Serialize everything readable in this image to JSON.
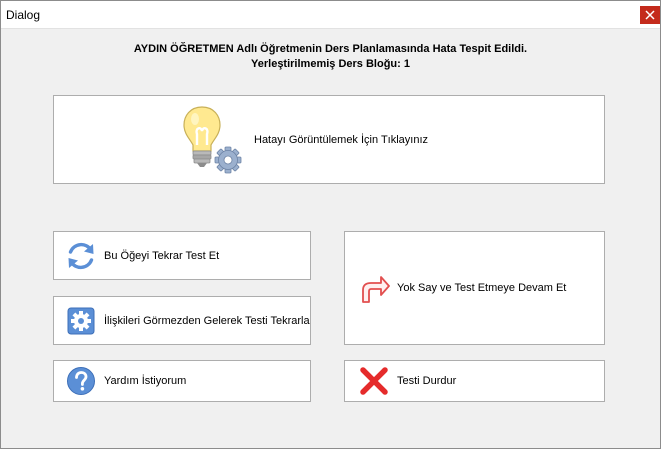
{
  "window": {
    "title": "Dialog"
  },
  "message": {
    "line1": "AYDIN ÖĞRETMEN Adlı Öğretmenin Ders Planlamasında Hata Tespit Edildi.",
    "line2": "Yerleştirilmemiş Ders Bloğu: 1"
  },
  "buttons": {
    "show_error": {
      "label": "Hatayı Görüntülemek İçin Tıklayınız",
      "icon": "lightbulb-gear-icon"
    },
    "retest": {
      "label": "Bu Öğeyi Tekrar Test Et",
      "icon": "refresh-icon"
    },
    "ignore_relations": {
      "label": "İlişkileri Görmezden Gelerek Testi Tekrarla",
      "icon": "gear-icon"
    },
    "help": {
      "label": "Yardım İstiyorum",
      "icon": "question-icon"
    },
    "skip": {
      "label": "Yok Say ve Test Etmeye Devam Et",
      "icon": "redirect-arrow-icon"
    },
    "stop": {
      "label": "Testi Durdur",
      "icon": "red-x-icon"
    }
  },
  "colors": {
    "close_button": "#c42b1c",
    "accent_blue": "#4a86d9",
    "stop_red": "#e52b2b",
    "bulb_yellow": "#ffe990"
  }
}
